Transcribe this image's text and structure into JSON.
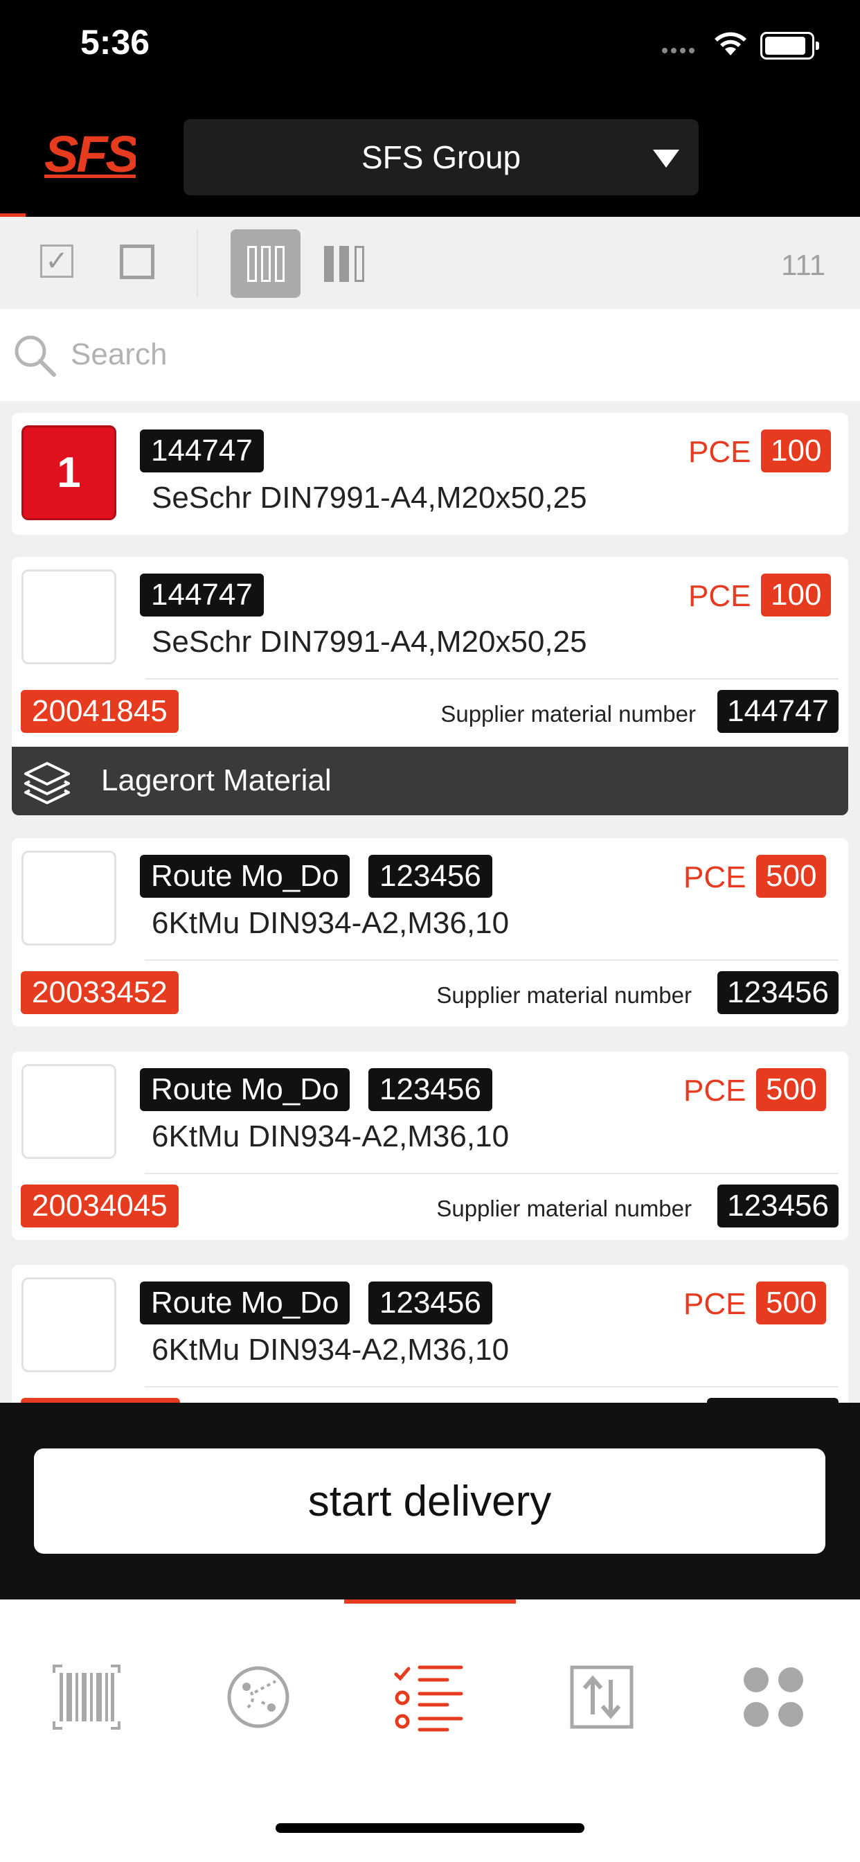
{
  "status": {
    "time": "5:36"
  },
  "header": {
    "logo": "SFS",
    "group": "SFS Group"
  },
  "toolbar": {
    "count": "111"
  },
  "search": {
    "placeholder": "Search"
  },
  "items": [
    {
      "index_badge": "1",
      "tag": "144747",
      "unit": "PCE",
      "qty": "100",
      "desc": "SeSchr DIN7991-A4,M20x50,25"
    },
    {
      "tag": "144747",
      "unit": "PCE",
      "qty": "100",
      "desc": "SeSchr DIN7991-A4,M20x50,25",
      "order": "20041845",
      "sup_label": "Supplier material number",
      "sup_num": "144747",
      "location": "Lagerort Material"
    },
    {
      "route": "Route Mo_Do",
      "tag": "123456",
      "unit": "PCE",
      "qty": "500",
      "desc": "6KtMu DIN934-A2,M36,10",
      "order": "20033452",
      "sup_label": "Supplier material number",
      "sup_num": "123456"
    },
    {
      "route": "Route Mo_Do",
      "tag": "123456",
      "unit": "PCE",
      "qty": "500",
      "desc": "6KtMu DIN934-A2,M36,10",
      "order": "20034045",
      "sup_label": "Supplier material number",
      "sup_num": "123456"
    },
    {
      "route": "Route Mo_Do",
      "tag": "123456",
      "unit": "PCE",
      "qty": "500",
      "desc": "6KtMu DIN934-A2,M36,10"
    }
  ],
  "bottom": {
    "start_label": "start delivery"
  },
  "colors": {
    "accent": "#e63b1f",
    "badge_red": "#e0101e",
    "dark": "#111111"
  },
  "tabs": [
    {
      "icon": "barcode-icon"
    },
    {
      "icon": "route-icon"
    },
    {
      "icon": "checklist-icon",
      "active": true
    },
    {
      "icon": "transfer-icon"
    },
    {
      "icon": "grid-icon"
    }
  ]
}
